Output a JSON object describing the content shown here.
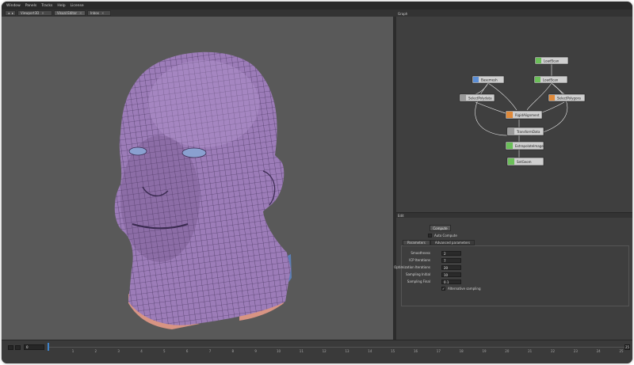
{
  "menu": [
    "Window",
    "Panels",
    "Tracks",
    "Help",
    "License"
  ],
  "tabs": [
    {
      "label": "Viewport3D",
      "active": false
    },
    {
      "label": "Visual Editor",
      "active": true
    },
    {
      "label": "Inbox",
      "active": false
    }
  ],
  "graph": {
    "title": "Graph",
    "nodes": [
      {
        "id": "loadscan",
        "label": "LoadScan"
      },
      {
        "id": "basemesh",
        "label": "Basemesh"
      },
      {
        "id": "loadscan2",
        "label": "LoadScan"
      },
      {
        "id": "selectpolydata",
        "label": "SelectPolydata"
      },
      {
        "id": "selectpolygons",
        "label": "SelectPolygons"
      },
      {
        "id": "rigidalignment",
        "label": "RigidAlignment"
      },
      {
        "id": "transformdata",
        "label": "TransformData"
      },
      {
        "id": "extrapolateimage",
        "label": "ExtrapolateImage"
      },
      {
        "id": "setgeom",
        "label": "SetGeom"
      }
    ]
  },
  "props": {
    "title": "Edit",
    "compute_label": "Compute",
    "auto_compute_label": "Auto Compute",
    "tabs": [
      "Parameters",
      "Advanced parameters"
    ],
    "fields": [
      {
        "label": "Smoothness",
        "value": "2"
      },
      {
        "label": "ICP Iterations",
        "value": "7"
      },
      {
        "label": "Optimization Iterations",
        "value": "20"
      },
      {
        "label": "Sampling Initial",
        "value": "10"
      },
      {
        "label": "Sampling Final",
        "value": "0.1"
      }
    ],
    "alternative_sampling_label": "Alternative sampling",
    "alternative_sampling_checked": true
  },
  "timeline": {
    "current_frame": "0",
    "ticks": [
      "1",
      "2",
      "3",
      "4",
      "5",
      "6",
      "7",
      "8",
      "9",
      "10",
      "11",
      "12",
      "13",
      "14",
      "15",
      "16",
      "17",
      "18",
      "19",
      "20",
      "21",
      "22",
      "23",
      "24",
      "25"
    ],
    "end_label": "25"
  },
  "colors": {
    "mesh_fill": "#9c7cb8",
    "mesh_line": "#3a2a50",
    "band_blue": "#5c7fb5",
    "band_salmon": "#d89483",
    "viewport_bg": "#595959",
    "timeline_marker": "#3f83c9"
  }
}
